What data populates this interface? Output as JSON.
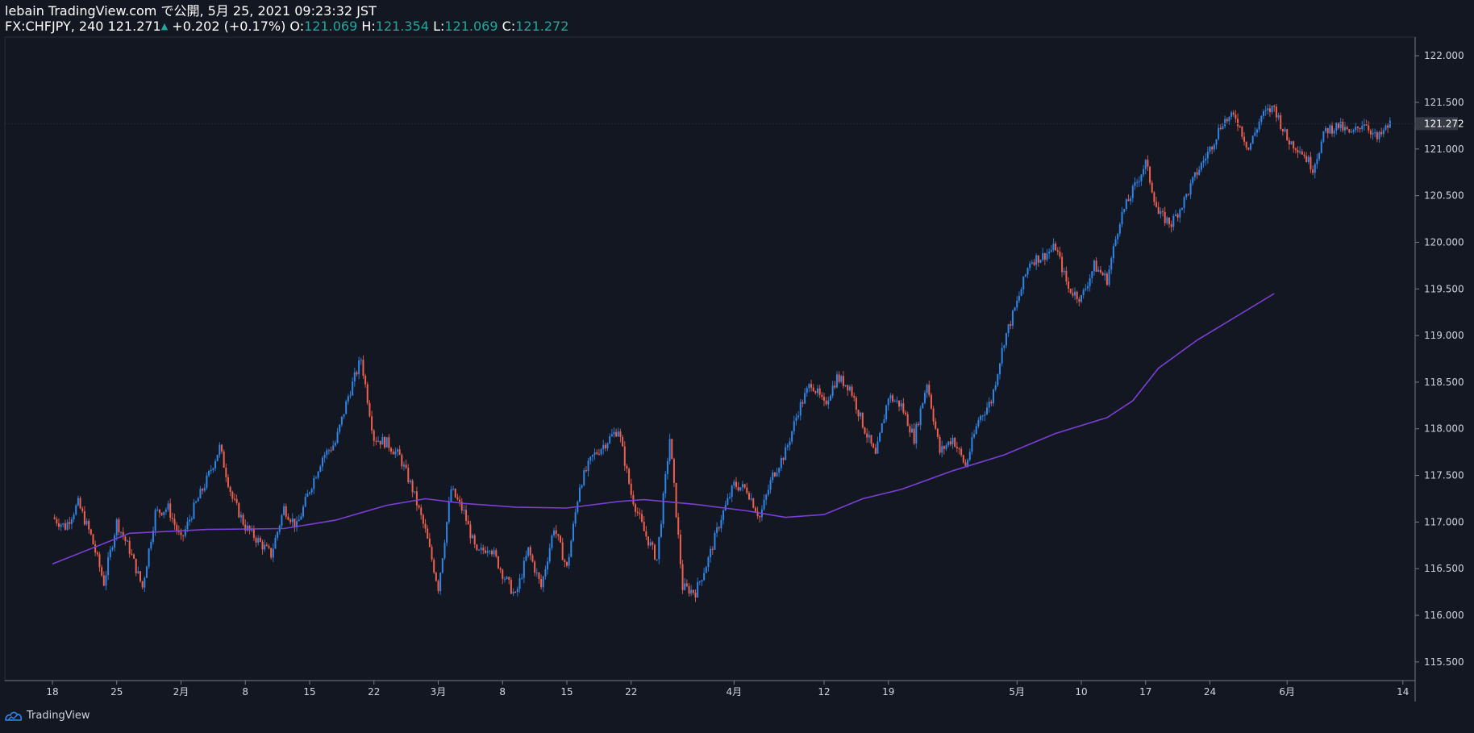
{
  "header": {
    "published": "lebain TradingView.com で公開, 5月 25, 2021 09:23:32 JST",
    "symbol": "FX:CHFJPY, 240",
    "last": "121.271",
    "change": "+0.202 (+0.17%)",
    "open_label": "O:",
    "open": "121.069",
    "high_label": "H:",
    "high": "121.354",
    "low_label": "L:",
    "low": "121.069",
    "close_label": "C:",
    "close": "121.272"
  },
  "footer": {
    "brand": "TradingView"
  },
  "colors": {
    "background": "#131722",
    "up": "#2f86e8",
    "down": "#f0604d",
    "ma": "#7b3fd6",
    "axis_text": "#d1d4dc",
    "accent_green": "#26a69a"
  },
  "chart_data": {
    "type": "candlestick",
    "timeframe": "240",
    "symbol": "FX:CHFJPY",
    "y_axis": {
      "ylim": [
        115.3,
        122.2
      ],
      "ticks": [
        "115.500",
        "116.000",
        "116.500",
        "117.000",
        "117.500",
        "118.000",
        "118.500",
        "119.000",
        "119.500",
        "120.000",
        "120.500",
        "121.000",
        "121.500",
        "122.000"
      ],
      "tick_values": [
        115.5,
        116.0,
        116.5,
        117.0,
        117.5,
        118.0,
        118.5,
        119.0,
        119.5,
        120.0,
        120.5,
        121.0,
        121.5,
        122.0
      ]
    },
    "last_price_label": "121.272",
    "last_price": 121.272,
    "x_axis": {
      "ticks": [
        "18",
        "25",
        "2月",
        "8",
        "15",
        "22",
        "3月",
        "8",
        "15",
        "22",
        "4月",
        "12",
        "19",
        "5月",
        "10",
        "17",
        "24",
        "6月",
        "14"
      ],
      "tick_index": [
        0,
        5,
        10,
        15,
        20,
        25,
        30,
        35,
        40,
        45,
        53,
        60,
        65,
        75,
        80,
        85,
        90,
        96,
        105
      ]
    },
    "price_path": [
      [
        0,
        117.05
      ],
      [
        1,
        116.95
      ],
      [
        2,
        117.2
      ],
      [
        3,
        116.85
      ],
      [
        4,
        116.35
      ],
      [
        5,
        117.0
      ],
      [
        6,
        116.7
      ],
      [
        7,
        116.3
      ],
      [
        8,
        117.1
      ],
      [
        9,
        117.15
      ],
      [
        10,
        116.8
      ],
      [
        11,
        117.15
      ],
      [
        12,
        117.45
      ],
      [
        13,
        117.8
      ],
      [
        14,
        117.25
      ],
      [
        15,
        116.95
      ],
      [
        16,
        116.8
      ],
      [
        17,
        116.65
      ],
      [
        18,
        117.15
      ],
      [
        19,
        116.95
      ],
      [
        20,
        117.35
      ],
      [
        21,
        117.7
      ],
      [
        22,
        117.85
      ],
      [
        23,
        118.35
      ],
      [
        24,
        118.75
      ],
      [
        25,
        117.9
      ],
      [
        26,
        117.85
      ],
      [
        27,
        117.7
      ],
      [
        28,
        117.35
      ],
      [
        29,
        116.9
      ],
      [
        30,
        116.3
      ],
      [
        31,
        117.35
      ],
      [
        32,
        117.1
      ],
      [
        33,
        116.65
      ],
      [
        34,
        116.75
      ],
      [
        35,
        116.45
      ],
      [
        36,
        116.2
      ],
      [
        37,
        116.7
      ],
      [
        38,
        116.3
      ],
      [
        39,
        116.95
      ],
      [
        40,
        116.5
      ],
      [
        41,
        117.4
      ],
      [
        42,
        117.7
      ],
      [
        43,
        117.85
      ],
      [
        44,
        118.0
      ],
      [
        45,
        117.3
      ],
      [
        46,
        116.9
      ],
      [
        47,
        116.6
      ],
      [
        48,
        117.9
      ],
      [
        49,
        116.3
      ],
      [
        50,
        116.25
      ],
      [
        51,
        116.6
      ],
      [
        52,
        117.05
      ],
      [
        53,
        117.4
      ],
      [
        54,
        117.35
      ],
      [
        55,
        117.05
      ],
      [
        56,
        117.5
      ],
      [
        57,
        117.75
      ],
      [
        58,
        118.2
      ],
      [
        59,
        118.5
      ],
      [
        60,
        118.25
      ],
      [
        61,
        118.55
      ],
      [
        62,
        118.45
      ],
      [
        63,
        118.05
      ],
      [
        64,
        117.7
      ],
      [
        65,
        118.35
      ],
      [
        66,
        118.25
      ],
      [
        67,
        117.9
      ],
      [
        68,
        118.5
      ],
      [
        69,
        117.75
      ],
      [
        70,
        117.9
      ],
      [
        71,
        117.6
      ],
      [
        72,
        118.1
      ],
      [
        73,
        118.3
      ],
      [
        74,
        118.95
      ],
      [
        75,
        119.35
      ],
      [
        76,
        119.8
      ],
      [
        77,
        119.85
      ],
      [
        78,
        119.95
      ],
      [
        79,
        119.5
      ],
      [
        80,
        119.4
      ],
      [
        81,
        119.75
      ],
      [
        82,
        119.6
      ],
      [
        83,
        120.25
      ],
      [
        84,
        120.55
      ],
      [
        85,
        120.85
      ],
      [
        86,
        120.3
      ],
      [
        87,
        120.2
      ],
      [
        88,
        120.45
      ],
      [
        89,
        120.75
      ],
      [
        90,
        121.0
      ],
      [
        91,
        121.3
      ],
      [
        92,
        121.35
      ],
      [
        93,
        121.0
      ],
      [
        94,
        121.35
      ],
      [
        95,
        121.45
      ],
      [
        96,
        121.1
      ],
      [
        97,
        121.0
      ],
      [
        98,
        120.8
      ],
      [
        99,
        121.2
      ],
      [
        100,
        121.25
      ],
      [
        101,
        121.15
      ],
      [
        102,
        121.3
      ],
      [
        103,
        121.1
      ],
      [
        104,
        121.27
      ]
    ],
    "ma_path": [
      [
        0,
        116.55
      ],
      [
        6,
        116.88
      ],
      [
        12,
        116.92
      ],
      [
        18,
        116.93
      ],
      [
        22,
        117.02
      ],
      [
        26,
        117.18
      ],
      [
        29,
        117.25
      ],
      [
        32,
        117.2
      ],
      [
        36,
        117.16
      ],
      [
        40,
        117.15
      ],
      [
        44,
        117.22
      ],
      [
        46,
        117.24
      ],
      [
        50,
        117.19
      ],
      [
        54,
        117.12
      ],
      [
        57,
        117.05
      ],
      [
        60,
        117.08
      ],
      [
        63,
        117.25
      ],
      [
        66,
        117.35
      ],
      [
        70,
        117.55
      ],
      [
        74,
        117.72
      ],
      [
        78,
        117.95
      ],
      [
        82,
        118.12
      ],
      [
        84,
        118.3
      ],
      [
        86,
        118.65
      ],
      [
        89,
        118.95
      ],
      [
        92,
        119.2
      ],
      [
        95,
        119.45
      ]
    ]
  }
}
